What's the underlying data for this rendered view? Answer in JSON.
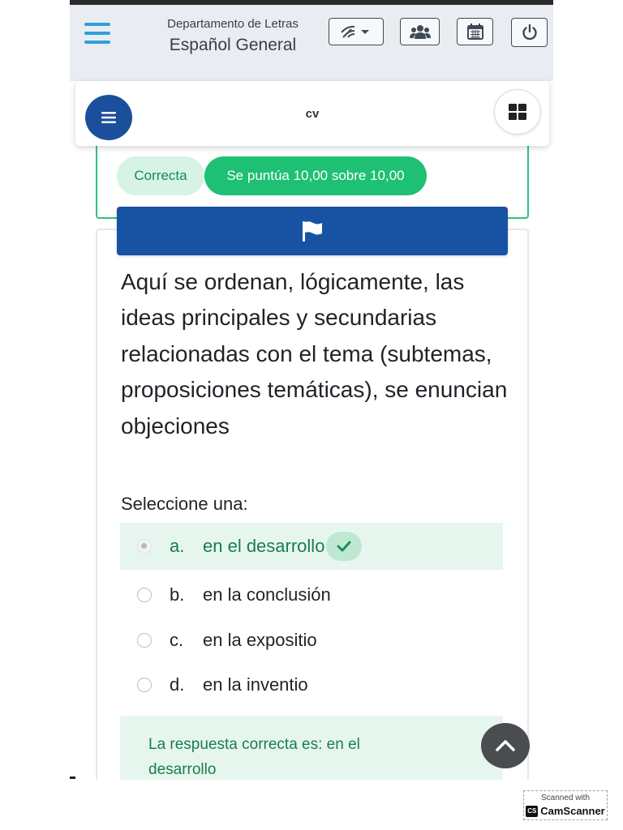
{
  "header": {
    "department": "Departamento de Letras",
    "course": "Español General",
    "icons": [
      "menu-icon",
      "wifi-dropdown-icon",
      "users-icon",
      "calendar-icon",
      "power-icon"
    ]
  },
  "quiz_nav": {
    "title": "cv",
    "icons": [
      "menu-icon",
      "grid-icon"
    ]
  },
  "previous_question": {
    "state": "Correcta",
    "grade": "Se puntúa 10,00 sobre 10,00"
  },
  "question": {
    "flag_icon": "flag-icon",
    "text": "Aquí se ordenan, lógicamente, las ideas principales y secundarias relacionadas con el tema (subtemas, proposiciones temáticas), se enuncian objeciones",
    "prompt": "Seleccione una:",
    "options": [
      {
        "letter": "a.",
        "label": "en el desarrollo",
        "selected": true,
        "correct": true
      },
      {
        "letter": "b.",
        "label": "en la conclusión",
        "selected": false
      },
      {
        "letter": "c.",
        "label": "en la expositio",
        "selected": false
      },
      {
        "letter": "d.",
        "label": "en la inventio",
        "selected": false
      }
    ],
    "feedback": "La respuesta correcta es: en el desarrollo"
  },
  "watermark": {
    "line1": "Scanned with",
    "brand_badge": "CS",
    "brand": "CamScanner"
  },
  "colors": {
    "primary": "#1752a3",
    "success": "#1ec073",
    "success_light": "#e6f6ef",
    "header_bg": "#e9edf1",
    "menu_accent": "#2f9fd8"
  }
}
